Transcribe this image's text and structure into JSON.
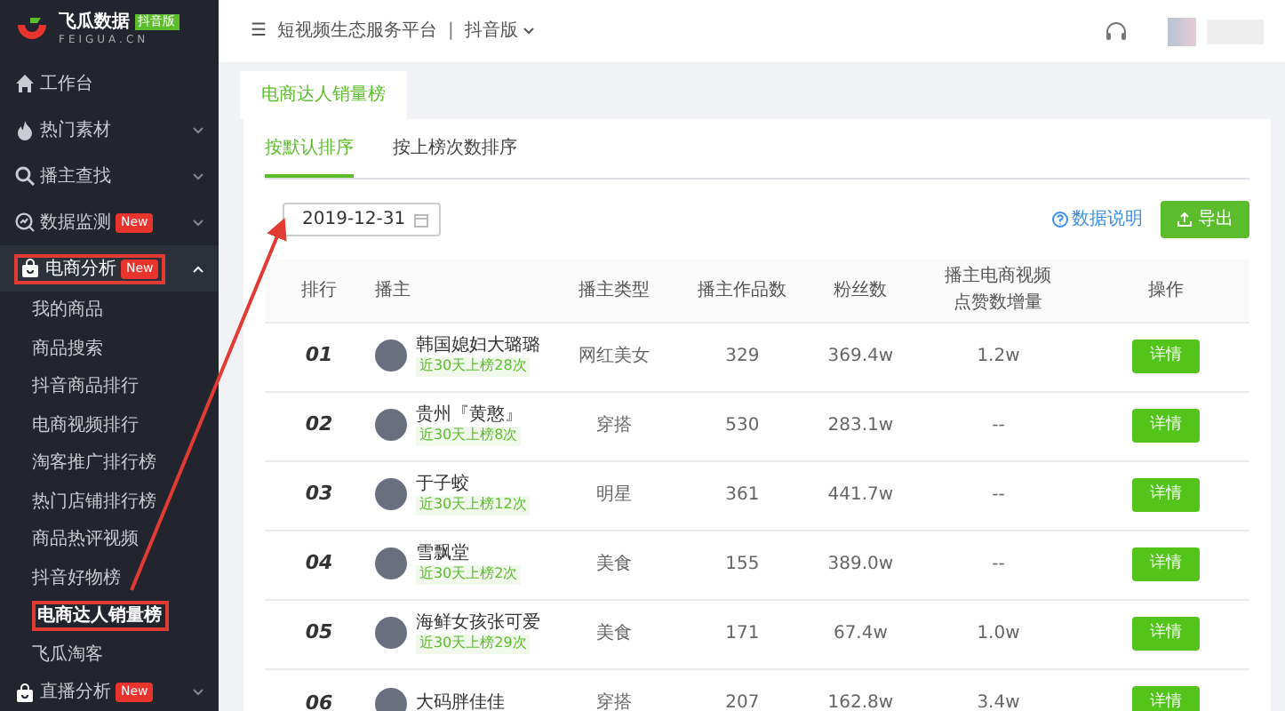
{
  "logo": {
    "name": "飞瓜数据",
    "badge": "抖音版",
    "domain": "FEIGUA.CN"
  },
  "sidebar": {
    "items": [
      {
        "label": "工作台",
        "expanded": false,
        "has_caret": false,
        "highlighted": false
      },
      {
        "label": "热门素材",
        "expanded": false,
        "has_caret": true,
        "highlighted": false
      },
      {
        "label": "播主查找",
        "expanded": false,
        "has_caret": true,
        "highlighted": false
      },
      {
        "label": "数据监测",
        "badge": "New",
        "expanded": false,
        "has_caret": true,
        "highlighted": false
      },
      {
        "label": "电商分析",
        "badge": "New",
        "expanded": true,
        "has_caret": true,
        "highlighted": true,
        "children": [
          {
            "label": "我的商品",
            "selected": false,
            "highlighted": false
          },
          {
            "label": "商品搜索",
            "selected": false,
            "highlighted": false
          },
          {
            "label": "抖音商品排行",
            "selected": false,
            "highlighted": false
          },
          {
            "label": "电商视频排行",
            "selected": false,
            "highlighted": false
          },
          {
            "label": "淘客推广排行榜",
            "selected": false,
            "highlighted": false
          },
          {
            "label": "热门店铺排行榜",
            "selected": false,
            "highlighted": false
          },
          {
            "label": "商品热评视频",
            "selected": false,
            "highlighted": false
          },
          {
            "label": "抖音好物榜",
            "selected": false,
            "highlighted": false
          },
          {
            "label": "电商达人销量榜",
            "selected": true,
            "highlighted": true
          },
          {
            "label": "飞瓜淘客",
            "selected": false,
            "highlighted": false
          }
        ]
      },
      {
        "label": "直播分析",
        "badge": "New",
        "expanded": false,
        "has_caret": true,
        "highlighted": false
      }
    ]
  },
  "topbar": {
    "menu_icon": "☰",
    "platform": "短视频生态服务平台",
    "separator": "|",
    "version": "抖音版"
  },
  "page_tab": "电商达人销量榜",
  "sort_tabs": [
    {
      "label": "按默认排序",
      "selected": true
    },
    {
      "label": "按上榜次数排序",
      "selected": false
    }
  ],
  "date": {
    "value": "2019-12-31"
  },
  "help_link": "数据说明",
  "export_button": "导出",
  "table": {
    "columns": [
      "排行",
      "播主",
      "播主类型",
      "播主作品数",
      "粉丝数",
      "播主电商视频点赞数增量",
      "操作"
    ],
    "rows": [
      {
        "rank": "01",
        "name": "韩国媳妇大璐璐",
        "note": "近30天上榜28次",
        "type": "网红美女",
        "works": "329",
        "fans": "369.4w",
        "growth": "1.2w",
        "action": "详情"
      },
      {
        "rank": "02",
        "name": "贵州『黄憨』",
        "note": "近30天上榜8次",
        "type": "穿搭",
        "works": "530",
        "fans": "283.1w",
        "growth": "--",
        "action": "详情"
      },
      {
        "rank": "03",
        "name": "于子蛟",
        "note": "近30天上榜12次",
        "type": "明星",
        "works": "361",
        "fans": "441.7w",
        "growth": "--",
        "action": "详情"
      },
      {
        "rank": "04",
        "name": "雪飘堂",
        "note": "近30天上榜2次",
        "type": "美食",
        "works": "155",
        "fans": "389.0w",
        "growth": "--",
        "action": "详情"
      },
      {
        "rank": "05",
        "name": "海鲜女孩张可爱",
        "note": "近30天上榜29次",
        "type": "美食",
        "works": "171",
        "fans": "67.4w",
        "growth": "1.0w",
        "action": "详情"
      },
      {
        "rank": "06",
        "name": "大码胖佳佳",
        "type": "穿搭",
        "works": "207",
        "fans": "162.8w",
        "growth": "3.4w",
        "action": "详情"
      }
    ]
  }
}
